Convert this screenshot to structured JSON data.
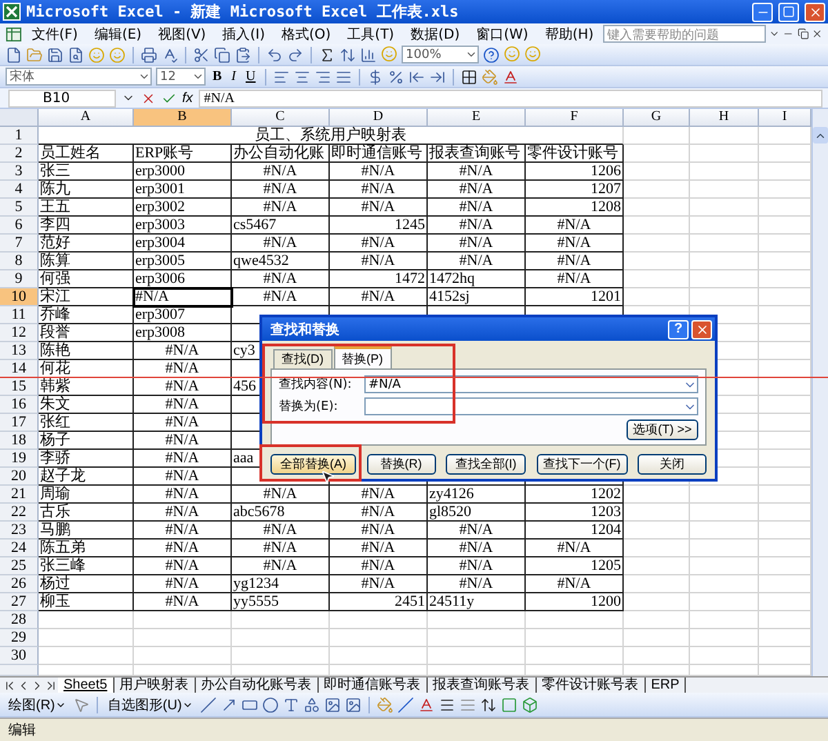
{
  "window": {
    "title": "Microsoft Excel - 新建 Microsoft Excel 工作表.xls"
  },
  "menu": [
    "文件(F)",
    "编辑(E)",
    "视图(V)",
    "插入(I)",
    "格式(O)",
    "工具(T)",
    "数据(D)",
    "窗口(W)",
    "帮助(H)"
  ],
  "help_box": {
    "placeholder": "键入需要帮助的问题"
  },
  "standard_toolbar": {
    "zoom": "100%"
  },
  "formatting_toolbar": {
    "font": "宋体",
    "size": "12",
    "style_buttons": [
      "B",
      "I",
      "U"
    ]
  },
  "formula_bar": {
    "cell": "B10",
    "function_button": "fx",
    "value": "#N/A"
  },
  "sheet": {
    "columns": [
      {
        "label": "A",
        "selected": false
      },
      {
        "label": "B",
        "selected": true
      },
      {
        "label": "C",
        "selected": false
      },
      {
        "label": "D",
        "selected": false
      },
      {
        "label": "E",
        "selected": false
      },
      {
        "label": "F",
        "selected": false
      },
      {
        "label": "G",
        "selected": false
      },
      {
        "label": "H",
        "selected": false
      },
      {
        "label": "I",
        "selected": false
      }
    ],
    "rows": [
      {
        "number": "1",
        "kind": "title",
        "selected": false,
        "cells": [
          {
            "text": "员工、系统用户映射表",
            "kind": "center"
          }
        ]
      },
      {
        "number": "2",
        "kind": "header",
        "selected": false,
        "cells": [
          {
            "text": "员工姓名",
            "kind": "text"
          },
          {
            "text": "ERP账号",
            "kind": "text"
          },
          {
            "text": "办公自动化账",
            "kind": "text"
          },
          {
            "text": "即时通信账号",
            "kind": "text"
          },
          {
            "text": "报表查询账号",
            "kind": "text"
          },
          {
            "text": "零件设计账号",
            "kind": "text"
          }
        ]
      },
      {
        "number": "3",
        "kind": "data",
        "selected": false,
        "cells": [
          {
            "text": "张三",
            "kind": "text"
          },
          {
            "text": "erp3000",
            "kind": "text"
          },
          {
            "text": "#N/A",
            "kind": "error"
          },
          {
            "text": "#N/A",
            "kind": "error"
          },
          {
            "text": "#N/A",
            "kind": "error"
          },
          {
            "text": "1206",
            "kind": "number"
          }
        ]
      },
      {
        "number": "4",
        "kind": "data",
        "selected": false,
        "cells": [
          {
            "text": "陈九",
            "kind": "text"
          },
          {
            "text": "erp3001",
            "kind": "text"
          },
          {
            "text": "#N/A",
            "kind": "error"
          },
          {
            "text": "#N/A",
            "kind": "error"
          },
          {
            "text": "#N/A",
            "kind": "error"
          },
          {
            "text": "1207",
            "kind": "number"
          }
        ]
      },
      {
        "number": "5",
        "kind": "data",
        "selected": false,
        "cells": [
          {
            "text": "王五",
            "kind": "text"
          },
          {
            "text": "erp3002",
            "kind": "text"
          },
          {
            "text": "#N/A",
            "kind": "error"
          },
          {
            "text": "#N/A",
            "kind": "error"
          },
          {
            "text": "#N/A",
            "kind": "error"
          },
          {
            "text": "1208",
            "kind": "number"
          }
        ]
      },
      {
        "number": "6",
        "kind": "data",
        "selected": false,
        "cells": [
          {
            "text": "李四",
            "kind": "text"
          },
          {
            "text": "erp3003",
            "kind": "text"
          },
          {
            "text": "cs5467",
            "kind": "text"
          },
          {
            "text": "1245",
            "kind": "number"
          },
          {
            "text": "#N/A",
            "kind": "error"
          },
          {
            "text": "#N/A",
            "kind": "error"
          }
        ]
      },
      {
        "number": "7",
        "kind": "data",
        "selected": false,
        "cells": [
          {
            "text": "范好",
            "kind": "text"
          },
          {
            "text": "erp3004",
            "kind": "text"
          },
          {
            "text": "#N/A",
            "kind": "error"
          },
          {
            "text": "#N/A",
            "kind": "error"
          },
          {
            "text": "#N/A",
            "kind": "error"
          },
          {
            "text": "#N/A",
            "kind": "error"
          }
        ]
      },
      {
        "number": "8",
        "kind": "data",
        "selected": false,
        "cells": [
          {
            "text": "陈算",
            "kind": "text"
          },
          {
            "text": "erp3005",
            "kind": "text"
          },
          {
            "text": "qwe4532",
            "kind": "text"
          },
          {
            "text": "#N/A",
            "kind": "error"
          },
          {
            "text": "#N/A",
            "kind": "error"
          },
          {
            "text": "#N/A",
            "kind": "error"
          }
        ]
      },
      {
        "number": "9",
        "kind": "data",
        "selected": false,
        "cells": [
          {
            "text": "何强",
            "kind": "text"
          },
          {
            "text": "erp3006",
            "kind": "text"
          },
          {
            "text": "#N/A",
            "kind": "error"
          },
          {
            "text": "1472",
            "kind": "number"
          },
          {
            "text": "1472hq",
            "kind": "text"
          },
          {
            "text": "#N/A",
            "kind": "error"
          }
        ]
      },
      {
        "number": "10",
        "kind": "data",
        "selected": true,
        "cells": [
          {
            "text": "宋江",
            "kind": "text"
          },
          {
            "text": "#N/A",
            "kind": "text"
          },
          {
            "text": "#N/A",
            "kind": "error"
          },
          {
            "text": "#N/A",
            "kind": "error"
          },
          {
            "text": "4152sj",
            "kind": "text"
          },
          {
            "text": "1201",
            "kind": "number"
          }
        ]
      },
      {
        "number": "11",
        "kind": "data",
        "selected": false,
        "cells": [
          {
            "text": "乔峰",
            "kind": "text"
          },
          {
            "text": "erp3007",
            "kind": "text"
          }
        ]
      },
      {
        "number": "12",
        "kind": "data",
        "selected": false,
        "cells": [
          {
            "text": "段誉",
            "kind": "text"
          },
          {
            "text": "erp3008",
            "kind": "text"
          }
        ]
      },
      {
        "number": "13",
        "kind": "data",
        "selected": false,
        "cells": [
          {
            "text": "陈艳",
            "kind": "text"
          },
          {
            "text": "#N/A",
            "kind": "error"
          },
          {
            "text": "cy3",
            "kind": "text"
          }
        ]
      },
      {
        "number": "14",
        "kind": "data",
        "selected": false,
        "cells": [
          {
            "text": "何花",
            "kind": "text"
          },
          {
            "text": "#N/A",
            "kind": "error"
          }
        ]
      },
      {
        "number": "15",
        "kind": "data",
        "selected": false,
        "cells": [
          {
            "text": "韩紫",
            "kind": "text"
          },
          {
            "text": "#N/A",
            "kind": "error"
          },
          {
            "text": "456",
            "kind": "text"
          }
        ]
      },
      {
        "number": "16",
        "kind": "data",
        "selected": false,
        "cells": [
          {
            "text": "朱文",
            "kind": "text"
          },
          {
            "text": "#N/A",
            "kind": "error"
          }
        ]
      },
      {
        "number": "17",
        "kind": "data",
        "selected": false,
        "cells": [
          {
            "text": "张红",
            "kind": "text"
          },
          {
            "text": "#N/A",
            "kind": "error"
          }
        ]
      },
      {
        "number": "18",
        "kind": "data",
        "selected": false,
        "cells": [
          {
            "text": "杨子",
            "kind": "text"
          },
          {
            "text": "#N/A",
            "kind": "error"
          }
        ]
      },
      {
        "number": "19",
        "kind": "data",
        "selected": false,
        "cells": [
          {
            "text": "李骄",
            "kind": "text"
          },
          {
            "text": "#N/A",
            "kind": "error"
          },
          {
            "text": "aaa",
            "kind": "text"
          }
        ]
      },
      {
        "number": "20",
        "kind": "data",
        "selected": false,
        "cells": [
          {
            "text": "赵子龙",
            "kind": "text"
          },
          {
            "text": "#N/A",
            "kind": "error"
          }
        ]
      },
      {
        "number": "21",
        "kind": "data",
        "selected": false,
        "cells": [
          {
            "text": "周瑜",
            "kind": "text"
          },
          {
            "text": "#N/A",
            "kind": "error"
          },
          {
            "text": "#N/A",
            "kind": "error"
          },
          {
            "text": "#N/A",
            "kind": "error"
          },
          {
            "text": "zy4126",
            "kind": "text"
          },
          {
            "text": "1202",
            "kind": "number"
          }
        ]
      },
      {
        "number": "22",
        "kind": "data",
        "selected": false,
        "cells": [
          {
            "text": "古乐",
            "kind": "text"
          },
          {
            "text": "#N/A",
            "kind": "error"
          },
          {
            "text": "abc5678",
            "kind": "text"
          },
          {
            "text": "#N/A",
            "kind": "error"
          },
          {
            "text": "gl8520",
            "kind": "text"
          },
          {
            "text": "1203",
            "kind": "number"
          }
        ]
      },
      {
        "number": "23",
        "kind": "data",
        "selected": false,
        "cells": [
          {
            "text": "马鹏",
            "kind": "text"
          },
          {
            "text": "#N/A",
            "kind": "error"
          },
          {
            "text": "#N/A",
            "kind": "error"
          },
          {
            "text": "#N/A",
            "kind": "error"
          },
          {
            "text": "#N/A",
            "kind": "error"
          },
          {
            "text": "1204",
            "kind": "number"
          }
        ]
      },
      {
        "number": "24",
        "kind": "data",
        "selected": false,
        "cells": [
          {
            "text": "陈五弟",
            "kind": "text"
          },
          {
            "text": "#N/A",
            "kind": "error"
          },
          {
            "text": "#N/A",
            "kind": "error"
          },
          {
            "text": "#N/A",
            "kind": "error"
          },
          {
            "text": "#N/A",
            "kind": "error"
          },
          {
            "text": "#N/A",
            "kind": "error"
          }
        ]
      },
      {
        "number": "25",
        "kind": "data",
        "selected": false,
        "cells": [
          {
            "text": "张三峰",
            "kind": "text"
          },
          {
            "text": "#N/A",
            "kind": "error"
          },
          {
            "text": "#N/A",
            "kind": "error"
          },
          {
            "text": "#N/A",
            "kind": "error"
          },
          {
            "text": "#N/A",
            "kind": "error"
          },
          {
            "text": "1205",
            "kind": "number"
          }
        ]
      },
      {
        "number": "26",
        "kind": "data",
        "selected": false,
        "cells": [
          {
            "text": "杨过",
            "kind": "text"
          },
          {
            "text": "#N/A",
            "kind": "error"
          },
          {
            "text": "yg1234",
            "kind": "text"
          },
          {
            "text": "#N/A",
            "kind": "error"
          },
          {
            "text": "#N/A",
            "kind": "error"
          },
          {
            "text": "#N/A",
            "kind": "error"
          }
        ]
      },
      {
        "number": "27",
        "kind": "data",
        "selected": false,
        "cells": [
          {
            "text": "柳玉",
            "kind": "text"
          },
          {
            "text": "#N/A",
            "kind": "error"
          },
          {
            "text": "yy5555",
            "kind": "text"
          },
          {
            "text": "2451",
            "kind": "number"
          },
          {
            "text": "24511y",
            "kind": "text"
          },
          {
            "text": "1200",
            "kind": "number"
          }
        ]
      },
      {
        "number": "28",
        "kind": "empty",
        "selected": false
      },
      {
        "number": "29",
        "kind": "empty",
        "selected": false
      },
      {
        "number": "30",
        "kind": "empty",
        "selected": false
      }
    ]
  },
  "sheet_tabs": [
    {
      "label": "Sheet5",
      "selected": true
    },
    {
      "label": "用户映射表",
      "selected": false
    },
    {
      "label": "办公自动化账号表",
      "selected": false
    },
    {
      "label": "即时通信账号表",
      "selected": false
    },
    {
      "label": "报表查询账号表",
      "selected": false
    },
    {
      "label": "零件设计账号表",
      "selected": false
    },
    {
      "label": "ERP",
      "selected": false
    }
  ],
  "drawing_toolbar": {
    "draw": "绘图(R)",
    "autoshapes": "自选图形(U)"
  },
  "status_bar": {
    "mode": "编辑"
  },
  "dialog": {
    "title": "查找和替换",
    "help_button": "?",
    "tabs": [
      {
        "label": "查找(D)",
        "selected": false
      },
      {
        "label": "替换(P)",
        "selected": true
      }
    ],
    "fields": [
      {
        "label": "查找内容(N):",
        "value": "#N/A"
      },
      {
        "label": "替换为(E):"
      }
    ],
    "options_button": "选项(T) >>",
    "buttons": [
      {
        "label": "全部替换(A)",
        "highlighted": true
      },
      {
        "label": "替换(R)",
        "highlighted": false
      },
      {
        "label": "查找全部(I)",
        "highlighted": false
      },
      {
        "label": "查找下一个(F)",
        "highlighted": false
      },
      {
        "label": "关闭",
        "highlighted": false
      }
    ]
  }
}
